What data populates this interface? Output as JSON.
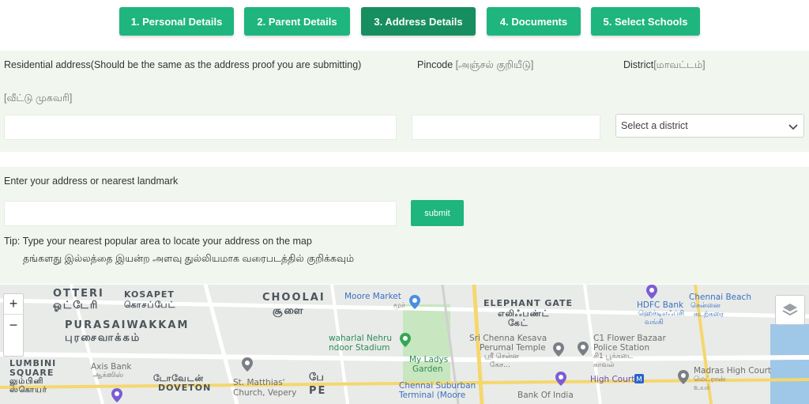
{
  "steps": [
    {
      "label": "1. Personal Details",
      "active": false
    },
    {
      "label": "2. Parent Details",
      "active": false
    },
    {
      "label": "3. Address Details",
      "active": true
    },
    {
      "label": "4. Documents",
      "active": false
    },
    {
      "label": "5. Select Schools",
      "active": false
    }
  ],
  "address_form": {
    "residential_label": "Residential address(Should be the same as the address proof you are submitting)",
    "residential_tamil": "[வீட்டு முகவரி]",
    "residential_value": "",
    "pincode_label": "Pincode",
    "pincode_tamil": "[அஞ்சல் குறியீடு]",
    "pincode_value": "",
    "district_label": "District",
    "district_tamil": "[மாவட்டம்]",
    "district_value": "Select a district"
  },
  "landmark": {
    "label": "Enter your address or nearest landmark",
    "value": "",
    "submit_label": "submit",
    "tip": "Tip: Type your nearest popular area to locate your address on the map",
    "tip_tamil": "தங்களது இல்லத்தை இயன்ற அளவு துல்லியமாக வரைபடத்தில் குறிக்கவும்"
  },
  "map": {
    "zoom_in": "+",
    "zoom_out": "−",
    "labels": {
      "otteri": "OTTERI",
      "otteri_ta": "ஓட்டேரி",
      "kosapet": "KOSAPET",
      "kosapet_ta": "கொசப்பேட்",
      "choolai": "CHOOLAI",
      "choolai_ta": "சூளை",
      "purasaiwakkam": "PURASAIWAKKAM",
      "purasaiwakkam_ta": "புரசைவாக்கம்",
      "lumbini": "LUMBINI",
      "square": "SQUARE",
      "lumbini_ta": "லும்பினி",
      "square_ta": "ஸ்கொயர்",
      "axis_bank": "Axis Bank",
      "axis_bank_ta": "ஆக்ஸிஸ்",
      "doveton_ta": "டோவேடன்",
      "doveton": "DOVETON",
      "st_matthias": "St. Matthias'",
      "st_matthias2": "Church, Vepery",
      "pe_ta": "பே",
      "pe": "PE",
      "moore_market": "Moore Market",
      "moore_market_ta": "மூர்",
      "jln_stadium": "waharlal Nehru",
      "jln_stadium2": "ndoor Stadium",
      "my_ladys": "My Ladys",
      "my_ladys2": "Garden",
      "chennai_suburban": "Chennai Suburban",
      "chennai_suburban2": "Terminal (Moore",
      "elephant_gate": "ELEPHANT GATE",
      "elephant_gate_ta": "எலிஃபண்ட்",
      "elephant_gate_ta2": "கேட்",
      "sri_chenna": "Sri Chenna Kesava",
      "perumal": "Perumal Temple",
      "perumal_ta": "ஸ்ரீ சென்ன",
      "perumal_ta2": "கேச...",
      "bank_of_india": "Bank Of India",
      "c1_flower": "C1 Flower Bazaar",
      "police_station": "Police Station",
      "police_ta": "சி1 பூக்கடை",
      "police_ta2": "காவல்",
      "high_court": "High Court",
      "hdfc": "HDFC Bank",
      "hdfc_ta": "ஹெச்டிஎஃப்சி",
      "hdfc_ta2": "வங்கி",
      "chennai_beach": "Chennai Beach",
      "chennai_beach_ta": "சென்னை",
      "chennai_beach_ta2": "கடற்கரை",
      "madras_hc": "Madras High Court",
      "madras_hc_ta": "மெட்ராஸ்",
      "madras_hc_ta2": "உயர்"
    }
  },
  "colors": {
    "step": "#1fb57e",
    "step_active": "#178e5f",
    "panel": "#f1f7ef",
    "map_bg": "#e9ebe8",
    "map_road": "#ffffff",
    "map_yellow_road": "#f5d76e",
    "map_park": "#c8e6c0",
    "map_water": "#9fc7e8"
  }
}
